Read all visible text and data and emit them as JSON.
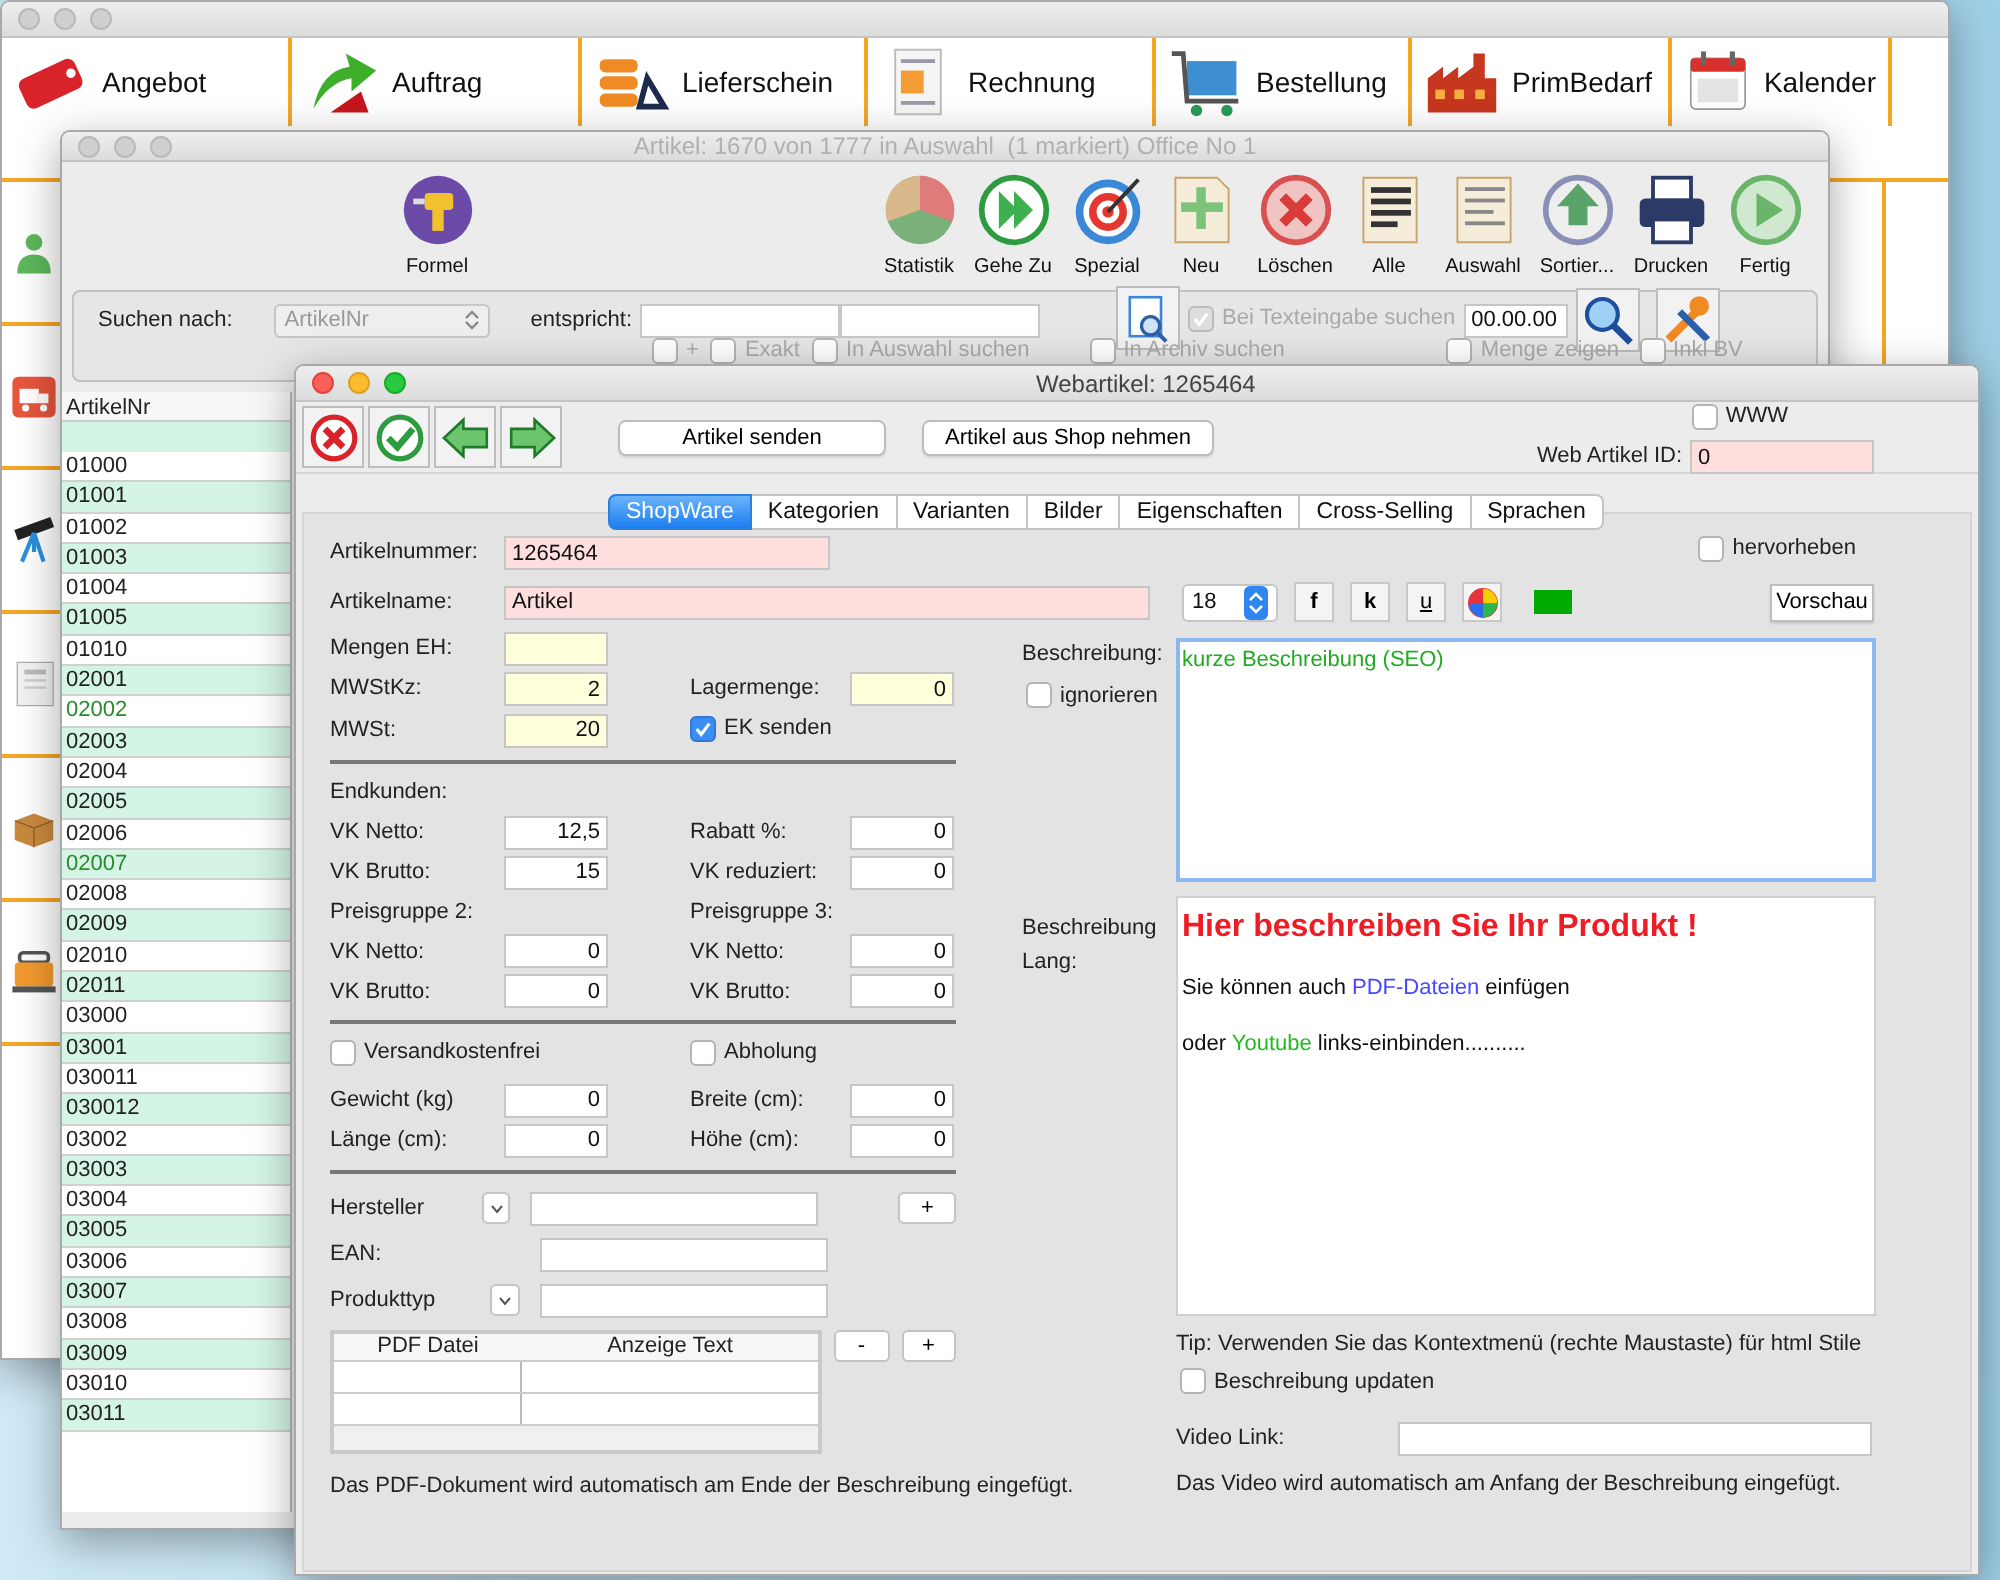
{
  "main_window": {
    "toolbar": [
      {
        "label": "Angebot"
      },
      {
        "label": "Auftrag"
      },
      {
        "label": "Lieferschein"
      },
      {
        "label": "Rechnung"
      },
      {
        "label": "Bestellung"
      },
      {
        "label": "PrimBedarf"
      },
      {
        "label": "Kalender"
      }
    ]
  },
  "article_window": {
    "title": "Artikel: 1670 von 1777 in Auswahl  (1 markiert) Office No 1",
    "toolbar": [
      {
        "label": "Formel"
      },
      {
        "label": "Statistik"
      },
      {
        "label": "Gehe Zu"
      },
      {
        "label": "Spezial"
      },
      {
        "label": "Neu"
      },
      {
        "label": "Löschen"
      },
      {
        "label": "Alle"
      },
      {
        "label": "Auswahl"
      },
      {
        "label": "Sortier..."
      },
      {
        "label": "Drucken"
      },
      {
        "label": "Fertig"
      }
    ],
    "search": {
      "label": "Suchen nach:",
      "field": "ArtikelNr",
      "match_label": "entspricht:",
      "options": [
        {
          "label": "+",
          "checked": false
        },
        {
          "label": "Exakt",
          "checked": false
        },
        {
          "label": "In Auswahl suchen",
          "checked": false
        },
        {
          "label": "In Archiv suchen",
          "checked": false
        }
      ],
      "text_search": {
        "label": "Bei Texteingabe suchen",
        "checked": true
      },
      "date": "00.00.00",
      "extra_options": [
        {
          "label": "Menge zeigen",
          "checked": false
        },
        {
          "label": "Inkl BV",
          "checked": false
        }
      ]
    },
    "list": {
      "column": "ArtikelNr",
      "rows": [
        {
          "value": "01000",
          "highlighted": false
        },
        {
          "value": "01001",
          "highlighted": false
        },
        {
          "value": "01002",
          "highlighted": false
        },
        {
          "value": "01003",
          "highlighted": false
        },
        {
          "value": "01004",
          "highlighted": false
        },
        {
          "value": "01005",
          "highlighted": false
        },
        {
          "value": "01010",
          "highlighted": false
        },
        {
          "value": "02001",
          "highlighted": false
        },
        {
          "value": "02002",
          "highlighted": true
        },
        {
          "value": "02003",
          "highlighted": false
        },
        {
          "value": "02004",
          "highlighted": false
        },
        {
          "value": "02005",
          "highlighted": false
        },
        {
          "value": "02006",
          "highlighted": false
        },
        {
          "value": "02007",
          "highlighted": true
        },
        {
          "value": "02008",
          "highlighted": false
        },
        {
          "value": "02009",
          "highlighted": false
        },
        {
          "value": "02010",
          "highlighted": false
        },
        {
          "value": "02011",
          "highlighted": false
        },
        {
          "value": "03000",
          "highlighted": false
        },
        {
          "value": "03001",
          "highlighted": false
        },
        {
          "value": "030011",
          "highlighted": false
        },
        {
          "value": "030012",
          "highlighted": false
        },
        {
          "value": "03002",
          "highlighted": false
        },
        {
          "value": "03003",
          "highlighted": false
        },
        {
          "value": "03004",
          "highlighted": false
        },
        {
          "value": "03005",
          "highlighted": false
        },
        {
          "value": "03006",
          "highlighted": false
        },
        {
          "value": "03007",
          "highlighted": false
        },
        {
          "value": "03008",
          "highlighted": false
        },
        {
          "value": "03009",
          "highlighted": false
        },
        {
          "value": "03010",
          "highlighted": false
        },
        {
          "value": "03011",
          "highlighted": false
        }
      ]
    }
  },
  "web_window": {
    "title": "Webartikel: 1265464",
    "buttons": [
      {
        "label": "Artikel senden"
      },
      {
        "label": "Artikel aus Shop nehmen"
      }
    ],
    "www": {
      "label": "WWW",
      "checked": false
    },
    "web_id": {
      "label": "Web Artikel ID:",
      "value": "0",
      "color": "#ffdede"
    },
    "tabs": [
      {
        "label": "ShopWare",
        "selected": true
      },
      {
        "label": "Kategorien",
        "selected": false
      },
      {
        "label": "Varianten",
        "selected": false
      },
      {
        "label": "Bilder",
        "selected": false
      },
      {
        "label": "Eigenschaften",
        "selected": false
      },
      {
        "label": "Cross-Selling",
        "selected": false
      },
      {
        "label": "Sprachen",
        "selected": false
      }
    ],
    "highlight": {
      "label": "hervorheben",
      "checked": false
    },
    "article_number": {
      "label": "Artikelnummer:",
      "value": "1265464",
      "color": "#ffdede"
    },
    "article_name": {
      "label": "Artikelname:",
      "value": "Artikel",
      "color": "#ffdede"
    },
    "font": {
      "size": "18",
      "bold": "f",
      "italic": "k",
      "underline": "u",
      "color": "#00aa00"
    },
    "preview": "Vorschau",
    "sections": [
      {
        "rows": [
          [
            {
              "kind": "field",
              "label": "Mengen EH:",
              "color": "#ffffdc"
            }
          ],
          [
            {
              "kind": "field",
              "label": "MWStKz:",
              "value": "2",
              "color": "#ffffdc"
            },
            {
              "kind": "field",
              "label": "Lagermenge:",
              "value": "0",
              "color": "#ffffdc"
            }
          ],
          [
            {
              "kind": "field",
              "label": "MWSt:",
              "value": "20",
              "color": "#ffffdc"
            },
            {
              "kind": "checkbox",
              "label": "EK senden",
              "checked": true
            }
          ]
        ]
      },
      {
        "rows": [
          [
            {
              "kind": "heading",
              "label": "Endkunden:"
            }
          ],
          [
            {
              "kind": "field",
              "label": "VK Netto:",
              "value": "12,5",
              "color": "#ffffff"
            },
            {
              "kind": "field",
              "label": "Rabatt %:",
              "value": "0",
              "color": "#ffffff"
            }
          ],
          [
            {
              "kind": "field",
              "label": "VK Brutto:",
              "value": "15",
              "color": "#ffffff"
            },
            {
              "kind": "field",
              "label": "VK reduziert:",
              "value": "0",
              "color": "#ffffff"
            }
          ],
          [
            {
              "kind": "heading",
              "label": "Preisgruppe 2:"
            },
            {
              "kind": "heading",
              "label": "Preisgruppe 3:"
            }
          ],
          [
            {
              "kind": "field",
              "label": "VK Netto:",
              "value": "0",
              "color": "#ffffff"
            },
            {
              "kind": "field",
              "label": "VK Netto:",
              "value": "0",
              "color": "#ffffff"
            }
          ],
          [
            {
              "kind": "field",
              "label": "VK Brutto:",
              "value": "0",
              "color": "#ffffff"
            },
            {
              "kind": "field",
              "label": "VK Brutto:",
              "value": "0",
              "color": "#ffffff"
            }
          ]
        ]
      },
      {
        "rows": [
          [
            {
              "kind": "checkbox",
              "label": "Versandkostenfrei",
              "checked": false
            },
            {
              "kind": "checkbox",
              "label": "Abholung",
              "checked": false
            }
          ],
          [
            {
              "kind": "field",
              "label": "Gewicht (kg)",
              "value": "0",
              "color": "#ffffff"
            },
            {
              "kind": "field",
              "label": "Breite (cm):",
              "value": "0",
              "color": "#ffffff"
            }
          ],
          [
            {
              "kind": "field",
              "label": "Länge (cm):",
              "value": "0",
              "color": "#ffffff"
            },
            {
              "kind": "field",
              "label": "Höhe (cm):",
              "value": "0",
              "color": "#ffffff"
            }
          ]
        ]
      }
    ],
    "manufacturer": {
      "label": "Hersteller",
      "add": "+"
    },
    "ean": {
      "label": "EAN:"
    },
    "product_type": {
      "label": "Produkttyp"
    },
    "pdf_table": {
      "columns": [
        "PDF Datei",
        "Anzeige Text"
      ],
      "remove": "-",
      "add": "+"
    },
    "pdf_note": "Das PDF-Dokument wird automatisch am Ende der Beschreibung eingefügt.",
    "short_description": {
      "label": "Beschreibung:",
      "ignore": {
        "label": "ignorieren",
        "checked": false
      },
      "text": "kurze Beschreibung (SEO)"
    },
    "long_description": {
      "label": "Beschreibung Lang:",
      "lines": [
        {
          "kind": "heading",
          "segments": [
            {
              "text": "Hier beschreiben Sie Ihr Produkt !",
              "color": "#ee1c25"
            }
          ]
        },
        {
          "kind": "text",
          "segments": [
            {
              "text": "Sie können auch ",
              "color": "#111111"
            },
            {
              "text": "PDF-Dateien",
              "color": "#4646ff"
            },
            {
              "text": " einfügen",
              "color": "#111111"
            }
          ]
        },
        {
          "kind": "text",
          "segments": [
            {
              "text": "oder ",
              "color": "#111111"
            },
            {
              "text": "Youtube",
              "color": "#22bb22"
            },
            {
              "text": " links-einbinden..........",
              "color": "#111111"
            }
          ]
        }
      ]
    },
    "tip": "Tip: Verwenden Sie das Kontextmenü (rechte Maustaste) für html Stile",
    "update": {
      "label": "Beschreibung updaten",
      "checked": false
    },
    "video": {
      "label": "Video Link:",
      "note": "Das Video wird automatisch am Anfang der Beschreibung eingefügt."
    }
  }
}
